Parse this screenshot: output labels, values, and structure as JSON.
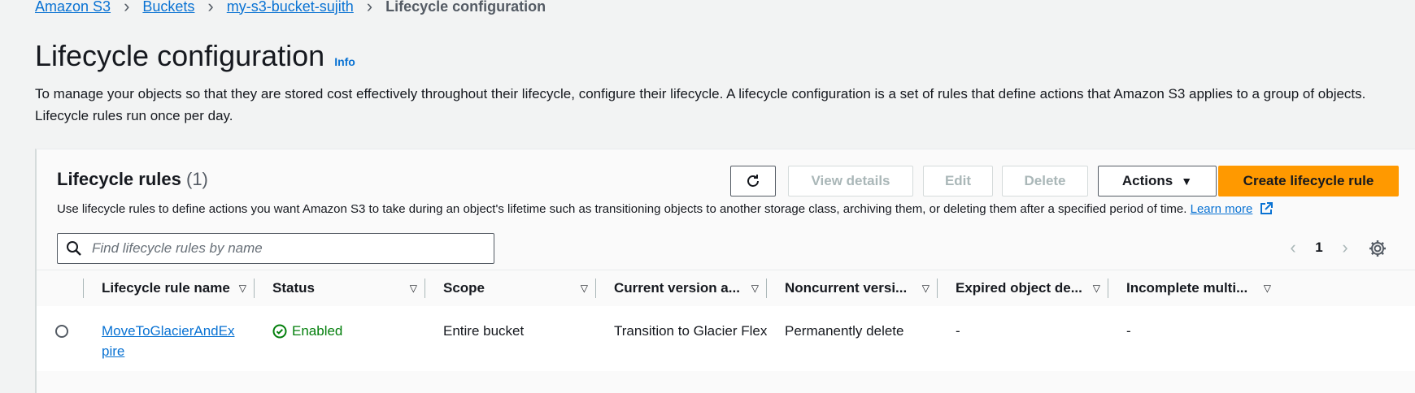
{
  "breadcrumb": {
    "items": [
      "Amazon S3",
      "Buckets",
      "my-s3-bucket-sujith"
    ],
    "current": "Lifecycle configuration"
  },
  "page": {
    "title": "Lifecycle configuration",
    "info": "Info",
    "description": "To manage your objects so that they are stored cost effectively throughout their lifecycle, configure their lifecycle. A lifecycle configuration is a set of rules that define actions that Amazon S3 applies to a group of objects. Lifecycle rules run once per day."
  },
  "panel": {
    "title": "Lifecycle rules",
    "count": "(1)",
    "description": "Use lifecycle rules to define actions you want Amazon S3 to take during an object's lifetime such as transitioning objects to another storage class, archiving them, or deleting them after a specified period of time.",
    "learn_more": "Learn more",
    "buttons": {
      "view_details": "View details",
      "edit": "Edit",
      "delete": "Delete",
      "actions": "Actions",
      "create": "Create lifecycle rule"
    },
    "search": {
      "placeholder": "Find lifecycle rules by name",
      "value": ""
    },
    "pagination": {
      "current_page": "1"
    }
  },
  "table": {
    "columns": [
      "Lifecycle rule name",
      "Status",
      "Scope",
      "Current version a...",
      "Noncurrent versi...",
      "Expired object de...",
      "Incomplete multi..."
    ],
    "rows": [
      {
        "name": "MoveToGlacierAndExpire",
        "status": "Enabled",
        "scope": "Entire bucket",
        "current_version": "Transition to Glacier Flexib",
        "noncurrent_version": "Permanently delete",
        "expired_object": "-",
        "incomplete_multipart": "-"
      }
    ]
  },
  "colors": {
    "link": "#0972d3",
    "primary_button": "#ff9900",
    "success": "#037f0c",
    "background": "#f2f3f3"
  }
}
